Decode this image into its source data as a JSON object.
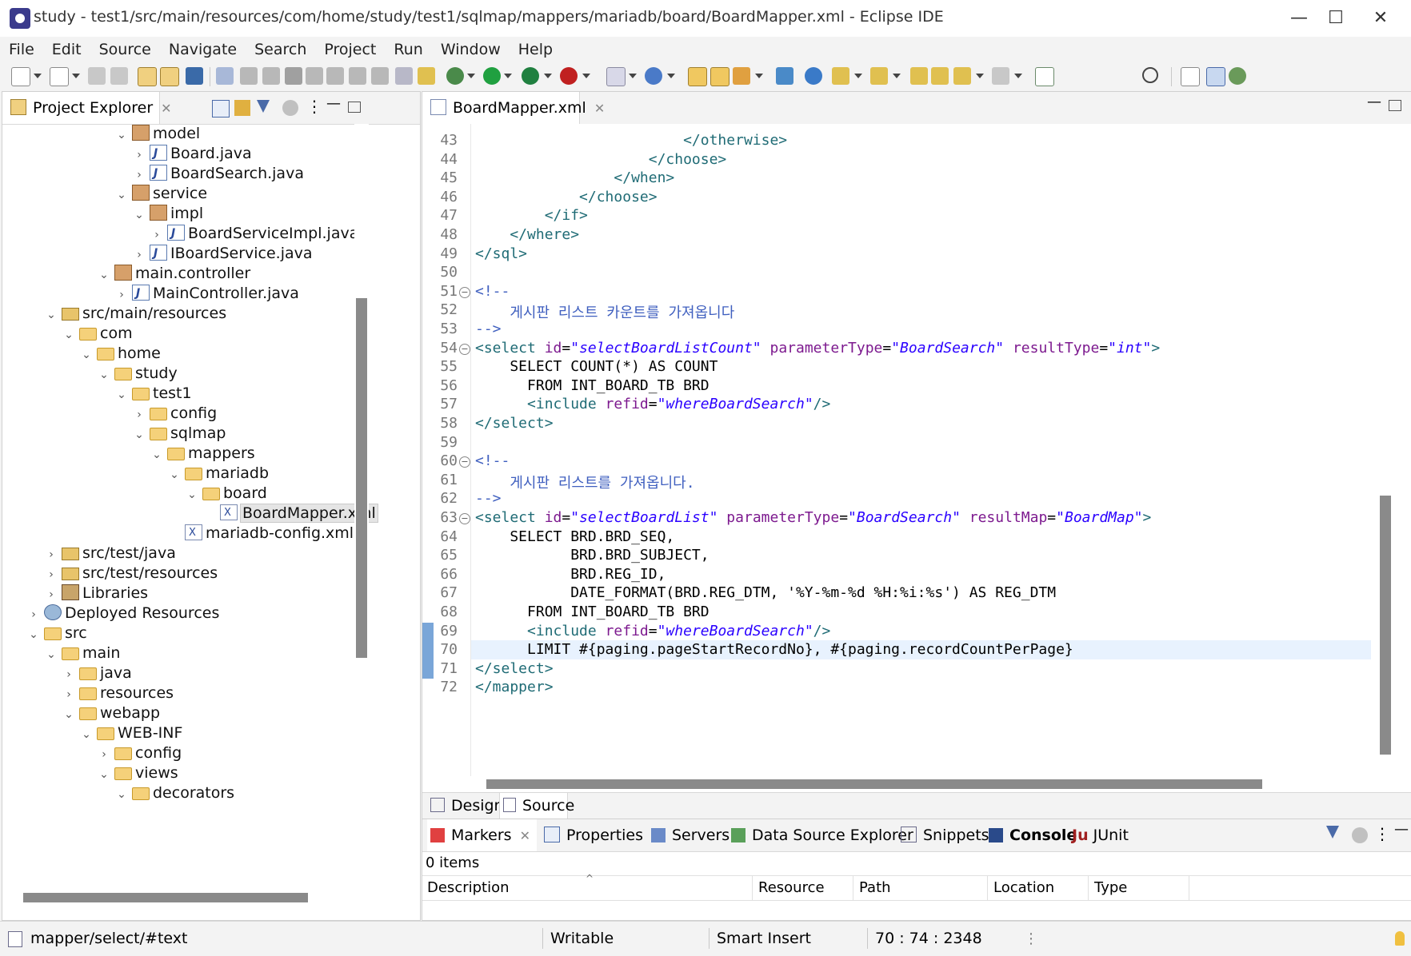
{
  "window": {
    "title": "study - test1/src/main/resources/com/home/study/test1/sqlmap/mappers/mariadb/board/BoardMapper.xml - Eclipse IDE",
    "minimize": "—",
    "maximize": "☐",
    "close": "✕"
  },
  "menu": [
    "File",
    "Edit",
    "Source",
    "Navigate",
    "Search",
    "Project",
    "Run",
    "Window",
    "Help"
  ],
  "explorer": {
    "tab_label": "Project Explorer",
    "tree": [
      {
        "label": "model",
        "depth": 6,
        "icon": "package-icon",
        "expanded": true
      },
      {
        "label": "Board.java",
        "depth": 7,
        "icon": "java-file-icon",
        "expanded": false
      },
      {
        "label": "BoardSearch.java",
        "depth": 7,
        "icon": "java-file-icon",
        "expanded": false
      },
      {
        "label": "service",
        "depth": 6,
        "icon": "package-icon",
        "expanded": true
      },
      {
        "label": "impl",
        "depth": 7,
        "icon": "package-icon",
        "expanded": true
      },
      {
        "label": "BoardServiceImpl.java",
        "depth": 8,
        "icon": "java-file-icon",
        "expanded": false
      },
      {
        "label": "IBoardService.java",
        "depth": 7,
        "icon": "java-interface-icon",
        "expanded": false
      },
      {
        "label": "main.controller",
        "depth": 5,
        "icon": "package-icon",
        "expanded": true
      },
      {
        "label": "MainController.java",
        "depth": 6,
        "icon": "java-file-icon",
        "expanded": false
      },
      {
        "label": "src/main/resources",
        "depth": 2,
        "icon": "source-folder-icon",
        "expanded": true
      },
      {
        "label": "com",
        "depth": 3,
        "icon": "folder-icon",
        "expanded": true
      },
      {
        "label": "home",
        "depth": 4,
        "icon": "folder-icon",
        "expanded": true
      },
      {
        "label": "study",
        "depth": 5,
        "icon": "folder-icon",
        "expanded": true
      },
      {
        "label": "test1",
        "depth": 6,
        "icon": "folder-icon",
        "expanded": true
      },
      {
        "label": "config",
        "depth": 7,
        "icon": "folder-icon",
        "expanded": false
      },
      {
        "label": "sqlmap",
        "depth": 7,
        "icon": "folder-icon",
        "expanded": true
      },
      {
        "label": "mappers",
        "depth": 8,
        "icon": "folder-icon",
        "expanded": true
      },
      {
        "label": "mariadb",
        "depth": 9,
        "icon": "folder-icon",
        "expanded": true
      },
      {
        "label": "board",
        "depth": 10,
        "icon": "folder-icon",
        "expanded": true
      },
      {
        "label": "BoardMapper.xml",
        "depth": 11,
        "icon": "xml-file-icon",
        "expanded": null,
        "selected": true
      },
      {
        "label": "mariadb-config.xml",
        "depth": 9,
        "icon": "xml-file-icon",
        "expanded": null
      },
      {
        "label": "src/test/java",
        "depth": 2,
        "icon": "source-folder-icon",
        "expanded": false
      },
      {
        "label": "src/test/resources",
        "depth": 2,
        "icon": "source-folder-icon",
        "expanded": false
      },
      {
        "label": "Libraries",
        "depth": 2,
        "icon": "library-icon",
        "expanded": false
      },
      {
        "label": "Deployed Resources",
        "depth": 1,
        "icon": "deployed-resources-icon",
        "expanded": false
      },
      {
        "label": "src",
        "depth": 1,
        "icon": "folder-icon",
        "expanded": true
      },
      {
        "label": "main",
        "depth": 2,
        "icon": "folder-icon",
        "expanded": true
      },
      {
        "label": "java",
        "depth": 3,
        "icon": "folder-icon",
        "expanded": false
      },
      {
        "label": "resources",
        "depth": 3,
        "icon": "folder-icon",
        "expanded": false
      },
      {
        "label": "webapp",
        "depth": 3,
        "icon": "folder-icon",
        "expanded": true
      },
      {
        "label": "WEB-INF",
        "depth": 4,
        "icon": "folder-icon",
        "expanded": true
      },
      {
        "label": "config",
        "depth": 5,
        "icon": "folder-icon",
        "expanded": false
      },
      {
        "label": "views",
        "depth": 5,
        "icon": "folder-icon",
        "expanded": true
      },
      {
        "label": "decorators",
        "depth": 6,
        "icon": "folder-icon",
        "expanded": true
      }
    ]
  },
  "editor": {
    "tab_label": "BoardMapper.xml",
    "lines": [
      {
        "n": "43",
        "fold": false,
        "parts": [
          [
            "tag",
            "                        </otherwise>"
          ]
        ]
      },
      {
        "n": "44",
        "fold": false,
        "parts": [
          [
            "tag",
            "                    </choose>"
          ]
        ]
      },
      {
        "n": "45",
        "fold": false,
        "parts": [
          [
            "tag",
            "                </when>"
          ]
        ]
      },
      {
        "n": "46",
        "fold": false,
        "parts": [
          [
            "tag",
            "            </choose>"
          ]
        ]
      },
      {
        "n": "47",
        "fold": false,
        "parts": [
          [
            "tag",
            "        </if>"
          ]
        ]
      },
      {
        "n": "48",
        "fold": false,
        "parts": [
          [
            "tag",
            "    </where>"
          ]
        ]
      },
      {
        "n": "49",
        "fold": false,
        "parts": [
          [
            "tag",
            "</sql>"
          ]
        ]
      },
      {
        "n": "50",
        "fold": false,
        "parts": [
          [
            "txt",
            ""
          ]
        ]
      },
      {
        "n": "51",
        "fold": true,
        "parts": [
          [
            "cmt",
            "<!--"
          ]
        ]
      },
      {
        "n": "52",
        "fold": false,
        "parts": [
          [
            "cmt",
            "    게시판 리스트 카운트를 가져옵니다"
          ]
        ]
      },
      {
        "n": "53",
        "fold": false,
        "parts": [
          [
            "cmt",
            "-->"
          ]
        ]
      },
      {
        "n": "54",
        "fold": true,
        "parts": [
          [
            "tag",
            "<select "
          ],
          [
            "attr",
            "id"
          ],
          [
            "txt",
            "="
          ],
          [
            "val",
            "\"selectBoardListCount\""
          ],
          [
            "attr",
            " parameterType"
          ],
          [
            "txt",
            "="
          ],
          [
            "val",
            "\"BoardSearch\""
          ],
          [
            "attr",
            " resultType"
          ],
          [
            "txt",
            "="
          ],
          [
            "val",
            "\"int\""
          ],
          [
            "tag",
            ">"
          ]
        ]
      },
      {
        "n": "55",
        "fold": false,
        "parts": [
          [
            "txt",
            "    SELECT COUNT(*) AS COUNT"
          ]
        ]
      },
      {
        "n": "56",
        "fold": false,
        "parts": [
          [
            "txt",
            "      FROM INT_BOARD_TB BRD"
          ]
        ]
      },
      {
        "n": "57",
        "fold": false,
        "parts": [
          [
            "tag",
            "      <include "
          ],
          [
            "attr",
            "refid"
          ],
          [
            "txt",
            "="
          ],
          [
            "val",
            "\"whereBoardSearch\""
          ],
          [
            "tag",
            "/>"
          ]
        ]
      },
      {
        "n": "58",
        "fold": false,
        "parts": [
          [
            "tag",
            "</select>"
          ]
        ]
      },
      {
        "n": "59",
        "fold": false,
        "parts": [
          [
            "txt",
            ""
          ]
        ]
      },
      {
        "n": "60",
        "fold": true,
        "parts": [
          [
            "cmt",
            "<!--"
          ]
        ]
      },
      {
        "n": "61",
        "fold": false,
        "parts": [
          [
            "cmt",
            "    게시판 리스트를 가져옵니다."
          ]
        ]
      },
      {
        "n": "62",
        "fold": false,
        "parts": [
          [
            "cmt",
            "-->"
          ]
        ]
      },
      {
        "n": "63",
        "fold": true,
        "parts": [
          [
            "tag",
            "<select "
          ],
          [
            "attr",
            "id"
          ],
          [
            "txt",
            "="
          ],
          [
            "val",
            "\"selectBoardList\""
          ],
          [
            "attr",
            " parameterType"
          ],
          [
            "txt",
            "="
          ],
          [
            "val",
            "\"BoardSearch\""
          ],
          [
            "attr",
            " resultMap"
          ],
          [
            "txt",
            "="
          ],
          [
            "val",
            "\"BoardMap\""
          ],
          [
            "tag",
            ">"
          ]
        ]
      },
      {
        "n": "64",
        "fold": false,
        "parts": [
          [
            "txt",
            "    SELECT BRD.BRD_SEQ,"
          ]
        ]
      },
      {
        "n": "65",
        "fold": false,
        "parts": [
          [
            "txt",
            "           BRD.BRD_SUBJECT,"
          ]
        ]
      },
      {
        "n": "66",
        "fold": false,
        "parts": [
          [
            "txt",
            "           BRD.REG_ID,"
          ]
        ]
      },
      {
        "n": "67",
        "fold": false,
        "parts": [
          [
            "txt",
            "           DATE_FORMAT(BRD.REG_DTM, '%Y-%m-%d %H:%i:%s') AS REG_DTM"
          ]
        ]
      },
      {
        "n": "68",
        "fold": false,
        "parts": [
          [
            "txt",
            "      FROM INT_BOARD_TB BRD"
          ]
        ]
      },
      {
        "n": "69",
        "fold": false,
        "parts": [
          [
            "tag",
            "      <include "
          ],
          [
            "attr",
            "refid"
          ],
          [
            "txt",
            "="
          ],
          [
            "val",
            "\"whereBoardSearch\""
          ],
          [
            "tag",
            "/>"
          ]
        ]
      },
      {
        "n": "70",
        "fold": false,
        "parts": [
          [
            "txt",
            "      LIMIT #{paging.pageStartRecordNo}, #{paging.recordCountPerPage}"
          ]
        ]
      },
      {
        "n": "71",
        "fold": false,
        "parts": [
          [
            "tag",
            "</select>"
          ]
        ]
      },
      {
        "n": "72",
        "fold": false,
        "parts": [
          [
            "tag",
            "</mapper>"
          ]
        ]
      }
    ],
    "bottom_tabs": [
      "Design",
      "Source"
    ]
  },
  "bottom_panel": {
    "tabs": [
      "Markers",
      "Properties",
      "Servers",
      "Data Source Explorer",
      "Snippets",
      "Console",
      "JUnit"
    ],
    "items_count": "0 items",
    "columns": [
      "Description",
      "Resource",
      "Path",
      "Location",
      "Type"
    ]
  },
  "statusbar": {
    "path": "mapper/select/#text",
    "writable": "Writable",
    "insert_mode": "Smart Insert",
    "position": "70 : 74 : 2348"
  },
  "colors": {
    "tag": "#1f6b75",
    "attr": "#7d1a8f",
    "value": "#2a00ff",
    "comment": "#3f5fbf",
    "current_line": "#e8f2fe"
  }
}
